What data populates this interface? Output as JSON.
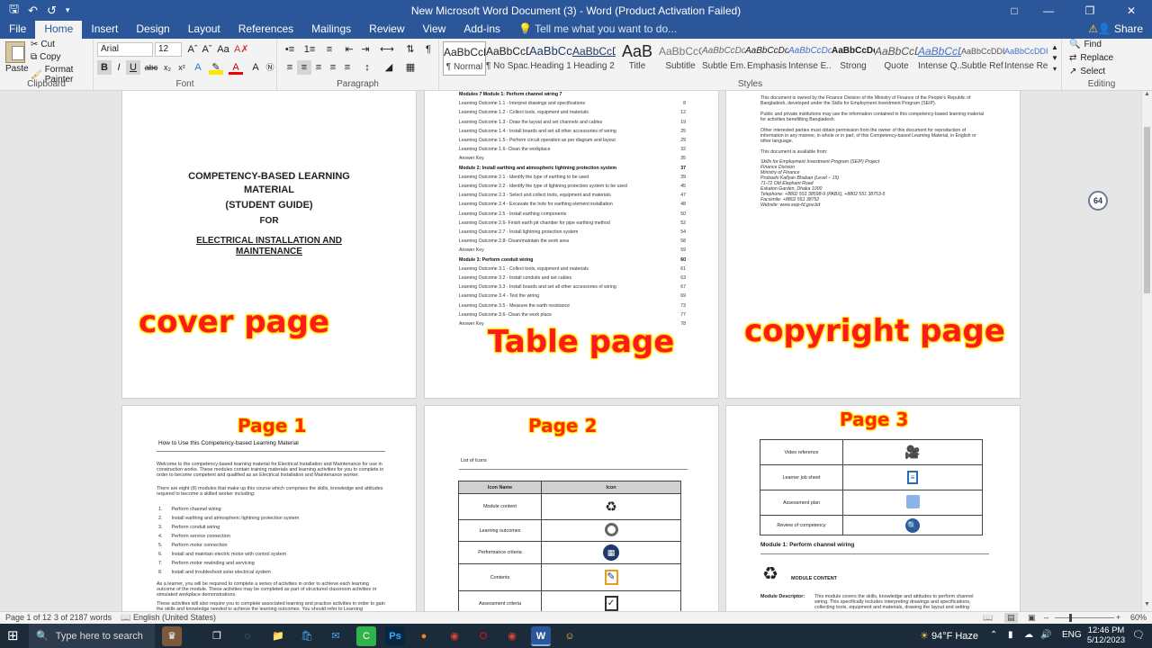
{
  "titlebar": {
    "title": "New Microsoft Word Document (3) - Word (Product Activation Failed)",
    "qat": [
      "save-icon",
      "undo-icon",
      "redo-icon"
    ]
  },
  "tabs": [
    "File",
    "Home",
    "Insert",
    "Design",
    "Layout",
    "References",
    "Mailings",
    "Review",
    "View",
    "Add-ins"
  ],
  "active_tab": "Home",
  "tell_me": "Tell me what you want to do...",
  "share_label": "Share",
  "ribbon": {
    "clipboard": {
      "label": "Clipboard",
      "paste": "Paste",
      "cut": "Cut",
      "copy": "Copy",
      "format_painter": "Format Painter"
    },
    "font": {
      "label": "Font",
      "family": "Arial",
      "size": "12"
    },
    "paragraph": {
      "label": "Paragraph"
    },
    "styles": {
      "label": "Styles",
      "items": [
        {
          "preview": "AaBbCcDı",
          "name": "¶ Normal"
        },
        {
          "preview": "AaBbCcDı",
          "name": "¶ No Spac..."
        },
        {
          "preview": "AaBbCcI",
          "name": "Heading 1"
        },
        {
          "preview": "AaBbCcD",
          "name": "Heading 2"
        },
        {
          "preview": "AaB",
          "name": "Title"
        },
        {
          "preview": "AaBbCcC",
          "name": "Subtitle"
        },
        {
          "preview": "AaBbCcDdi",
          "name": "Subtle Em..."
        },
        {
          "preview": "AaBbCcDdi",
          "name": "Emphasis"
        },
        {
          "preview": "AaBbCcDdi",
          "name": "Intense E..."
        },
        {
          "preview": "AaBbCcDdl",
          "name": "Strong"
        },
        {
          "preview": "AaBbCcD",
          "name": "Quote"
        },
        {
          "preview": "AaBbCcD",
          "name": "Intense Q..."
        },
        {
          "preview": "AaBbCcDDE",
          "name": "Subtle Ref..."
        },
        {
          "preview": "AaBbCcDDI",
          "name": "Intense Re..."
        }
      ]
    },
    "editing": {
      "label": "Editing",
      "find": "Find",
      "replace": "Replace",
      "select": "Select"
    }
  },
  "pages": {
    "cover": {
      "line1": "COMPETENCY-BASED LEARNING",
      "line2": "MATERIAL",
      "line3": "(STUDENT GUIDE)",
      "line4": "FOR",
      "line5": "ELECTRICAL INSTALLATION AND",
      "line6": "MAINTENANCE",
      "annotation": "cover page"
    },
    "toc": {
      "annotation": "Table page",
      "lines": [
        {
          "t": "Modules            7 Module 1: Perform channel wiring    7",
          "p": "",
          "b": true
        },
        {
          "t": "Learning Outcome 1.1 - Interpret drawings and specifications",
          "p": "8"
        },
        {
          "t": "Learning Outcome 1.2 - Collect tools, equipment and materials",
          "p": "12"
        },
        {
          "t": "Learning Outcome 1.3 - Draw the layout and set channels and cables",
          "p": "19"
        },
        {
          "t": "Learning Outcome 1.4 - Install boards and set all other accessories of wiring",
          "p": "25"
        },
        {
          "t": "Learning Outcome 1.5 - Perform circuit operation as per diagram and layout",
          "p": "29"
        },
        {
          "t": "Learning Outcome 1.6- Clean the workplace",
          "p": "32"
        },
        {
          "t": "Answer Key",
          "p": "35"
        },
        {
          "t": "Module 2: Install earthing and atmospheric lightning protection system",
          "p": "37",
          "b": true
        },
        {
          "t": "Learning Outcome 2.1 - Identify the type of earthing to be used",
          "p": "39"
        },
        {
          "t": "Learning Outcome 2.2 - Identify the type of lightning protection system to be used",
          "p": "45"
        },
        {
          "t": "Learning Outcome 2.3 - Select and collect tools, equipment and materials",
          "p": "47"
        },
        {
          "t": "Learning Outcome 2.4 - Excavate the hole for earthing element installation",
          "p": "48"
        },
        {
          "t": "Learning Outcome 2.5 - Install earthing components",
          "p": "50"
        },
        {
          "t": "Learning Outcome 2.6- Finish earth pit chamber for pipe earthing method",
          "p": "52"
        },
        {
          "t": "Learning Outcome 2.7 - Install lightning protection system",
          "p": "54"
        },
        {
          "t": "Learning Outcome 2.8- Clean/maintain the work area",
          "p": "58"
        },
        {
          "t": "Answer Key",
          "p": "59"
        },
        {
          "t": "Module 3: Perform conduit wiring",
          "p": "60",
          "b": true
        },
        {
          "t": "Learning Outcome 3.1 - Collect tools, equipment and materials",
          "p": "61"
        },
        {
          "t": "Learning Outcome 3.2 - Install conduits and set cables",
          "p": "63"
        },
        {
          "t": "Learning Outcome 3.3 - Install boards and set all other accessories of wiring",
          "p": "67"
        },
        {
          "t": "Learning Outcome 3.4 - Test the wiring",
          "p": "69"
        },
        {
          "t": "Learning Outcome 3.5 - Measure the earth resistance",
          "p": "73"
        },
        {
          "t": "Learning Outcome 3.6- Clean the work place",
          "p": "77"
        },
        {
          "t": "Answer Key",
          "p": "78"
        }
      ]
    },
    "copyright": {
      "annotation": "copyright page",
      "p1": "This document is owned by the Finance Division of the Ministry of Finance of the People's Republic of Bangladesh, developed under the Skills for Employment Investment Program (SEIP).",
      "p2": "Public and private institutions may use the information contained in this competency-based learning material for activities benefitting Bangladesh.",
      "p3": "Other interested parties must obtain permission from the owner of this document for reproduction of information in any manner, in whole or in part, of this Competency-based Learning Material, in English or other language.",
      "p4": "This document is available from:",
      "addr": [
        "Skills for Employment Investment Program (SEIP) Project",
        "Finance Division",
        "Ministry of Finance",
        "Probashi Kallyan Bhaban (Level – 15)",
        "71-72 Old Elephant Road",
        "Eskaton Garden, Dhaka 1000",
        "Telephone: +8802 551 38598-9 (PABX), +8802 551 38753-5",
        "Facsimile: +8802 551 38752",
        "Website: www.seip-fd.gov.bd"
      ],
      "badge": "64"
    },
    "page1": {
      "annotation": "Page 1",
      "heading": "How to Use this Competency-based Learning Material",
      "intro": "Welcome to the competency-based learning material for Electrical Installation and Maintenance for use in construction works. These modules contain training materials and learning activities for you to complete in order to become competent and qualified as an Electrical Installation and Maintenance worker.",
      "intro2": "There are eight (8) modules that make up this course which comprises the skills, knowledge and attitudes required to become a skilled worker including:",
      "list": [
        "Perform channel wiring",
        "Install earthing and atmospheric lightning protection system",
        "Perform conduit wiring",
        "Perform service connection",
        "Perform motor connection",
        "Install and maintain electric motor with control system",
        "Perform motor rewinding and servicing",
        "Install and troubleshoot solar electrical system"
      ],
      "outro": "As a learner, you will be required to complete a series of activities in order to achieve each learning outcome of the module. These activities may be completed as part of structured classroom activities or simulated workplace demonstrations.",
      "outro2": "These activities will also require you to complete associated learning and practice activities in order to gain the skills and knowledge needed to achieve the learning outcomes. You should refer to Learning"
    },
    "page2": {
      "annotation": "Page 2",
      "heading": "List of Icons",
      "col1": "Icon Name",
      "col2": "Icon",
      "rows": [
        "Module content",
        "Learning outcomes",
        "Performance criteria",
        "Contents",
        "Assessment criteria"
      ]
    },
    "page3": {
      "annotation": "Page 3",
      "rows": [
        "Video reference",
        "Learner job sheet",
        "Assessment plan",
        "Review of competency"
      ],
      "module_heading": "Module 1: Perform channel wiring",
      "module_content": "MODULE CONTENT",
      "descriptor_label": "Module Descriptor:",
      "descriptor": "This module covers the skills, knowledge and attitudes to perform channel wiring. This specifically includes interpreting drawings and specifications, collecting tools, equipment and materials, drawing the layout and setting channels and"
    }
  },
  "status": {
    "page": "Page 1 of 12",
    "words": "3 of 2187 words",
    "language": "English (United States)",
    "zoom": "60%"
  },
  "taskbar": {
    "search": "Type here to search",
    "weather": "94°F  Haze",
    "lang": "ENG",
    "time": "12:46 PM",
    "date": "5/12/2023"
  }
}
